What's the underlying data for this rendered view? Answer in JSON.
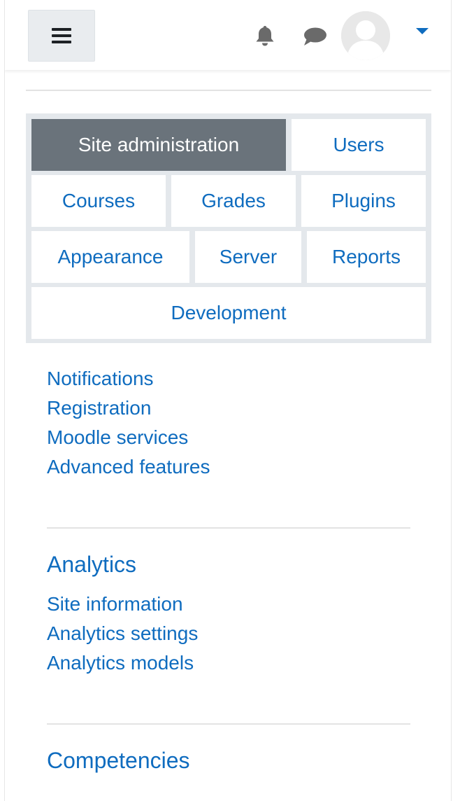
{
  "navbar": {
    "menu_icon": "hamburger-icon",
    "notifications_icon": "bell-icon",
    "messages_icon": "chat-bubble-icon",
    "user_menu_icon": "caret-down-icon"
  },
  "tabs": {
    "items": [
      {
        "label": "Site administration",
        "active": true
      },
      {
        "label": "Users",
        "active": false
      },
      {
        "label": "Courses",
        "active": false
      },
      {
        "label": "Grades",
        "active": false
      },
      {
        "label": "Plugins",
        "active": false
      },
      {
        "label": "Appearance",
        "active": false
      },
      {
        "label": "Server",
        "active": false
      },
      {
        "label": "Reports",
        "active": false
      },
      {
        "label": "Development",
        "active": false
      }
    ]
  },
  "general_links": [
    {
      "label": "Notifications"
    },
    {
      "label": "Registration"
    },
    {
      "label": "Moodle services"
    },
    {
      "label": "Advanced features"
    }
  ],
  "analytics": {
    "heading": "Analytics",
    "links": [
      {
        "label": "Site information"
      },
      {
        "label": "Analytics settings"
      },
      {
        "label": "Analytics models"
      }
    ]
  },
  "competencies": {
    "heading": "Competencies"
  },
  "colors": {
    "link": "#0f6cbf",
    "active_tab": "#6a737b",
    "tab_container": "#e4e8ec",
    "hamburger_bg": "#e9ecef"
  }
}
